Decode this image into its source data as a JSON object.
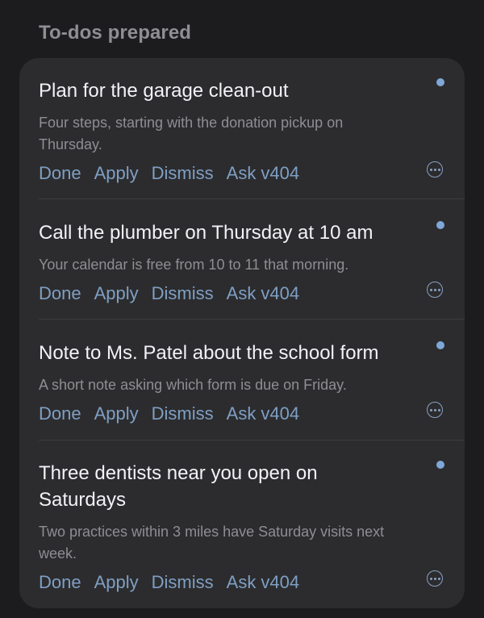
{
  "section": {
    "title": "To-dos prepared"
  },
  "items": [
    {
      "title": "Plan for the garage clean-out",
      "description": "Four steps, starting with the donation pickup on Thursday.",
      "actions": [
        "Done",
        "Apply",
        "Dismiss",
        "Ask v404"
      ]
    },
    {
      "title": "Call the plumber on Thursday at 10 am",
      "description": "Your calendar is free from 10 to 11 that morning.",
      "actions": [
        "Done",
        "Apply",
        "Dismiss",
        "Ask v404"
      ]
    },
    {
      "title": "Note to Ms. Patel about the school form",
      "description": "A short note asking which form is due on Friday.",
      "actions": [
        "Done",
        "Apply",
        "Dismiss",
        "Ask v404"
      ]
    },
    {
      "title": "Three dentists near you open on Saturdays",
      "description": "Two practices within 3 miles have Saturday visits next week.",
      "actions": [
        "Done",
        "Apply",
        "Dismiss",
        "Ask v404"
      ]
    }
  ],
  "icons": {
    "unread": "unread-dot-icon",
    "more": "more-options-icon"
  },
  "colors": {
    "background": "#1c1c1e",
    "card": "#2c2c2e",
    "accent": "#7f9fc4",
    "unread_dot": "#7fa7d8"
  }
}
